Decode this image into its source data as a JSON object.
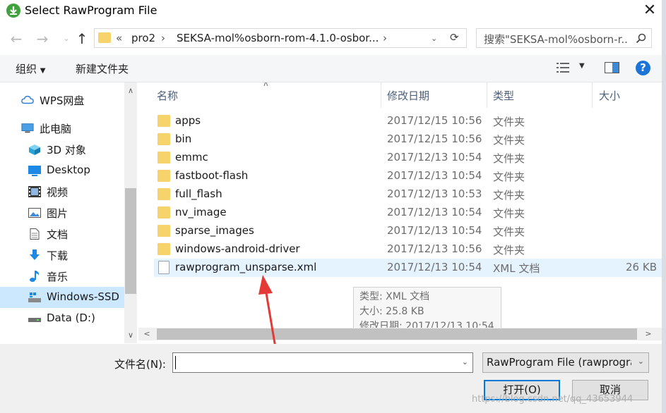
{
  "window": {
    "title": "Select RawProgram File",
    "close_glyph": "✕"
  },
  "nav": {
    "back_glyph": "←",
    "forward_glyph": "→",
    "up_glyph": "↑",
    "breadcrumb": {
      "overflow": "«",
      "segments": [
        "pro2",
        "SEKSA-mol%osborn-rom-4.1.0-osbor..."
      ]
    },
    "search_placeholder": "搜索\"SEKSA-mol%osborn-r..."
  },
  "toolbar": {
    "organize": "组织",
    "new_folder": "新建文件夹",
    "help_glyph": "?"
  },
  "sidebar": {
    "items": [
      {
        "label": "WPS网盘",
        "icon": "cloud-icon"
      },
      {
        "label": "此电脑",
        "icon": "computer-icon"
      },
      {
        "label": "3D 对象",
        "icon": "cube-icon"
      },
      {
        "label": "Desktop",
        "icon": "desktop-icon"
      },
      {
        "label": "视频",
        "icon": "video-icon"
      },
      {
        "label": "图片",
        "icon": "picture-icon"
      },
      {
        "label": "文档",
        "icon": "document-icon"
      },
      {
        "label": "下载",
        "icon": "download-icon"
      },
      {
        "label": "音乐",
        "icon": "music-icon"
      },
      {
        "label": "Windows-SSD",
        "icon": "drive-icon",
        "selected": true
      },
      {
        "label": "Data (D:)",
        "icon": "drive-icon"
      }
    ]
  },
  "list": {
    "columns": [
      "名称",
      "修改日期",
      "类型",
      "大小"
    ],
    "files": [
      {
        "name": "apps",
        "date": "2017/12/15 10:56",
        "type": "文件夹",
        "size": ""
      },
      {
        "name": "bin",
        "date": "2017/12/15 10:56",
        "type": "文件夹",
        "size": ""
      },
      {
        "name": "emmc",
        "date": "2017/12/13 10:54",
        "type": "文件夹",
        "size": ""
      },
      {
        "name": "fastboot-flash",
        "date": "2017/12/13 10:54",
        "type": "文件夹",
        "size": ""
      },
      {
        "name": "full_flash",
        "date": "2017/12/13 10:53",
        "type": "文件夹",
        "size": ""
      },
      {
        "name": "nv_image",
        "date": "2017/12/13 10:54",
        "type": "文件夹",
        "size": ""
      },
      {
        "name": "sparse_images",
        "date": "2017/12/13 10:54",
        "type": "文件夹",
        "size": ""
      },
      {
        "name": "windows-android-driver",
        "date": "2017/12/13 10:56",
        "type": "文件夹",
        "size": ""
      },
      {
        "name": "rawprogram_unsparse.xml",
        "date": "2017/12/13 10:54",
        "type": "XML 文档",
        "size": "26 KB"
      }
    ],
    "tooltip": {
      "type": "类型: XML 文档",
      "size": "大小: 25.8 KB",
      "modified": "修改日期: 2017/12/13 10:54"
    }
  },
  "bottom": {
    "filename_label": "文件名(N):",
    "filename_value": "",
    "filter": "RawProgram File (rawprogra",
    "open_button": "打开(O)",
    "cancel_button": "取消"
  },
  "watermark": "https://blog.csdn.net/qq_43653944",
  "colors": {
    "accent": "#0078d7",
    "selection": "#cce8ff",
    "annotation_arrow": "#e53935",
    "folder": "#f7d36b"
  }
}
